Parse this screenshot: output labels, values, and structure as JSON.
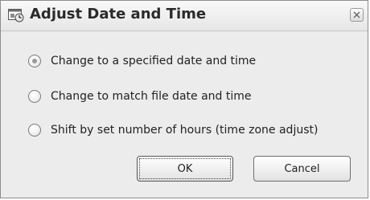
{
  "dialog": {
    "title": "Adjust Date and Time",
    "icon": "clock-window-icon",
    "close_icon": "close-icon"
  },
  "options": [
    {
      "label": "Change to a specified date and time",
      "selected": true
    },
    {
      "label": "Change to match file date and time",
      "selected": false
    },
    {
      "label": "Shift by set number of hours (time zone adjust)",
      "selected": false
    }
  ],
  "buttons": {
    "ok_label": "OK",
    "cancel_label": "Cancel"
  }
}
